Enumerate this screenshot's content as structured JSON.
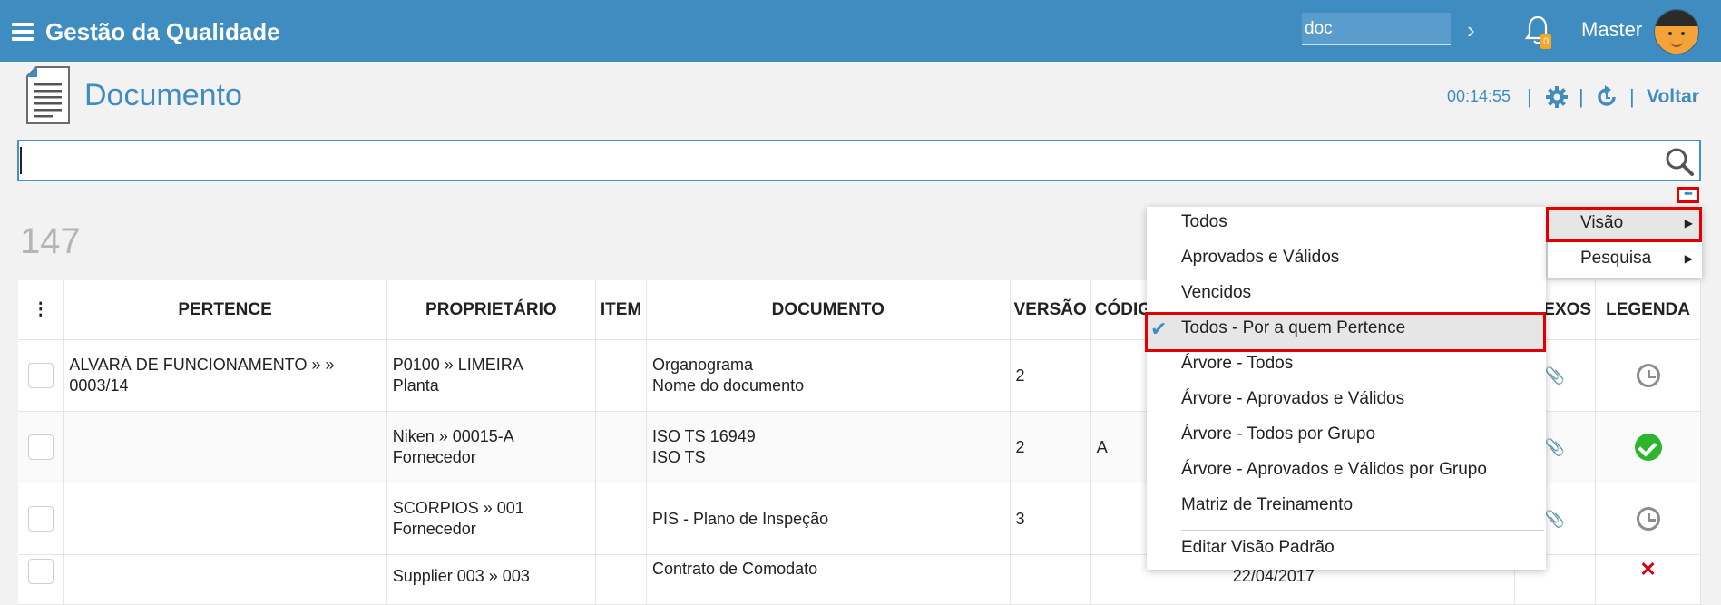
{
  "app": {
    "title": "Gestão da Qualidade",
    "search_value": "doc",
    "user_name": "Master",
    "notification_count": "0"
  },
  "page": {
    "title": "Documento",
    "timer": "00:14:55",
    "back_label": "Voltar",
    "record_count": "147"
  },
  "icons": {
    "menu": "hamburger-icon",
    "notify": "bell-icon",
    "settings": "gear-icon",
    "refresh": "refresh-icon",
    "search": "search-icon",
    "more": "ellipsis-icon",
    "attach": "paperclip-icon"
  },
  "table": {
    "menu_header": "⋮",
    "headers": [
      "PERTENCE",
      "PROPRIETÁRIO",
      "ITEM",
      "DOCUMENTO",
      "VERSÃO",
      "CÓDIG",
      "ANEXOS",
      "LEGENDA"
    ],
    "rows": [
      {
        "pertence": "ALVARÁ DE FUNCIONAMENTO » » 0003/14",
        "proprietario_1": "P0100 » LIMEIRA",
        "proprietario_2": "Planta",
        "documento_1": "Organograma",
        "documento_2": "Nome do documento",
        "versao": "2",
        "codigo": "",
        "legenda": "pending"
      },
      {
        "pertence": "",
        "proprietario_1": "Niken » 00015-A",
        "proprietario_2": "Fornecedor",
        "documento_1": "ISO TS 16949",
        "documento_2": "ISO TS",
        "versao": "2",
        "codigo": "A",
        "legenda": "approved"
      },
      {
        "pertence": "",
        "proprietario_1": "SCORPIOS » 001",
        "proprietario_2": "Fornecedor",
        "documento_1": "PIS - Plano de Inspeção",
        "documento_2": "",
        "versao": "3",
        "codigo": "",
        "legenda": "pending"
      },
      {
        "pertence": "",
        "proprietario_1": "Supplier 003 » 003",
        "proprietario_2": "",
        "documento_1": "Contrato de Comodato",
        "documento_2": "",
        "versao": "",
        "codigo": "",
        "date": "22/04/2017",
        "legenda": "rejected"
      }
    ]
  },
  "view_menu": {
    "items": [
      "Todos",
      "Aprovados e Válidos",
      "Vencidos",
      "Todos - Por a quem Pertence",
      "Árvore - Todos",
      "Árvore - Aprovados e Válidos",
      "Árvore - Todos por Grupo",
      "Árvore - Aprovados e Válidos por Grupo",
      "Matriz de Treinamento"
    ],
    "selected_index": 3,
    "edit_default": "Editar Visão Padrão"
  },
  "submenu": {
    "visao": "Visão",
    "pesquisa": "Pesquisa"
  },
  "colors": {
    "brand": "#3f8cc0",
    "highlight_border": "#e00000",
    "approved": "#2eb52e"
  }
}
